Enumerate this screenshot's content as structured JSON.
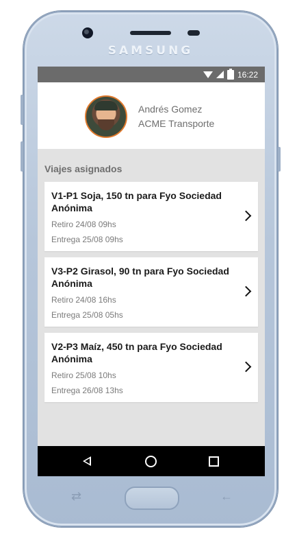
{
  "device": {
    "brand": "SAMSUNG"
  },
  "statusbar": {
    "time": "16:22",
    "icons": [
      "wifi-icon",
      "signal-icon",
      "battery-icon"
    ]
  },
  "profile": {
    "name": "Andrés Gomez",
    "company": "ACME Transporte",
    "avatar_border_color": "#e07a2d"
  },
  "section": {
    "title": "Viajes asignados"
  },
  "trips": [
    {
      "title": "V1-P1 Soja, 150 tn para Fyo Sociedad Anónima",
      "pickup": "Retiro 24/08 09hs",
      "delivery": "Entrega 25/08 09hs"
    },
    {
      "title": "V3-P2 Girasol, 90 tn para Fyo Sociedad Anónima",
      "pickup": "Retiro 24/08 16hs",
      "delivery": "Entrega 25/08 05hs"
    },
    {
      "title": "V2-P3 Maíz, 450 tn para Fyo Sociedad Anónima",
      "pickup": "Retiro 25/08 10hs",
      "delivery": "Entrega 26/08 13hs"
    }
  ],
  "navbar": {
    "icons": [
      "nav-back-icon",
      "nav-home-icon",
      "nav-recents-icon"
    ]
  },
  "colors": {
    "statusbar": "#6b6b6b",
    "background": "#e2e2e2",
    "card": "#ffffff",
    "navbar": "#000000"
  }
}
